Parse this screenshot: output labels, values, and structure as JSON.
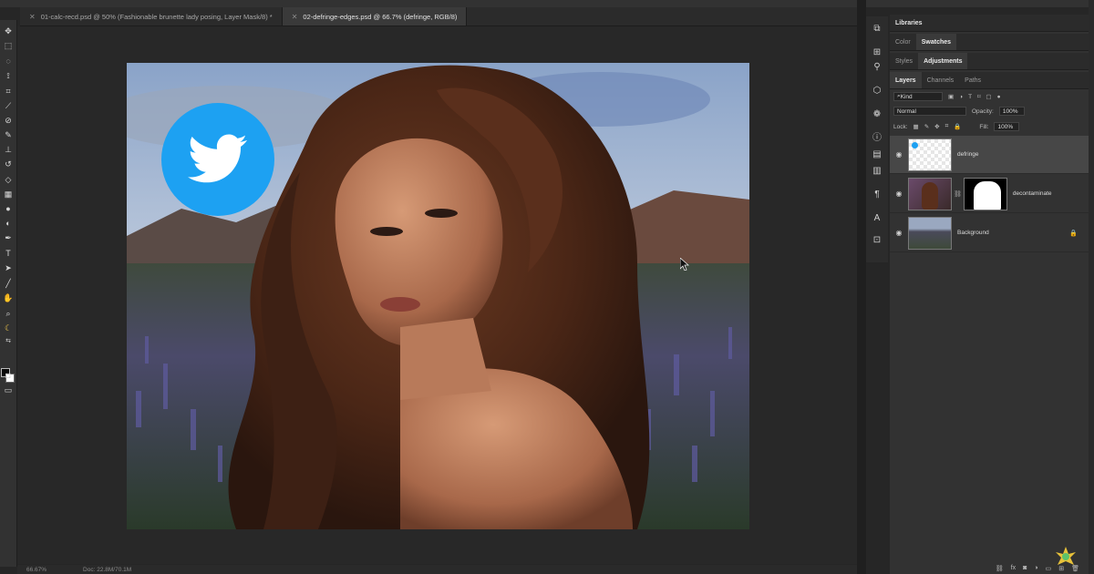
{
  "tabs": [
    {
      "label": "01-calc-recd.psd @ 50% (Fashionable brunette lady posing, Layer Mask/8) *",
      "active": false
    },
    {
      "label": "02-defringe-edges.psd @ 66.7% (defringe, RGB/8)",
      "active": true
    }
  ],
  "tools": [
    "move-tool",
    "marquee-tool",
    "lasso-tool",
    "quick-select-tool",
    "crop-tool",
    "eyedropper-tool",
    "healing-tool",
    "brush-tool",
    "stamp-tool",
    "history-brush-tool",
    "eraser-tool",
    "gradient-tool",
    "blur-tool",
    "dodge-tool",
    "pen-tool",
    "type-tool",
    "path-select-tool",
    "line-tool",
    "hand-tool",
    "zoom-tool",
    "banana-tool"
  ],
  "status": {
    "zoom": "66.67%",
    "doc": "Doc: 22.8M/70.1M"
  },
  "panels": {
    "top_tabs": [
      "Libraries"
    ],
    "color_tabs": [
      "Color",
      "Swatches"
    ],
    "adjust_tabs": [
      "Styles",
      "Adjustments"
    ],
    "layers_tabs": [
      "Layers",
      "Channels",
      "Paths"
    ]
  },
  "layers_panel": {
    "filter": "Kind",
    "blend_mode": "Normal",
    "opacity_label": "Opacity:",
    "opacity_value": "100%",
    "lock_label": "Lock:",
    "fill_label": "Fill:",
    "fill_value": "100%",
    "layers": [
      {
        "name": "defringe",
        "selected": true
      },
      {
        "name": "decontaminate",
        "selected": false
      },
      {
        "name": "Background",
        "selected": false,
        "locked": true
      }
    ]
  },
  "colors": {
    "twitter_blue": "#1da1f2",
    "panel_bg": "#323232",
    "canvas_bg": "#282828"
  },
  "icons": [
    "twitter-bird-icon",
    "eye-icon",
    "lock-icon",
    "link-icon"
  ]
}
